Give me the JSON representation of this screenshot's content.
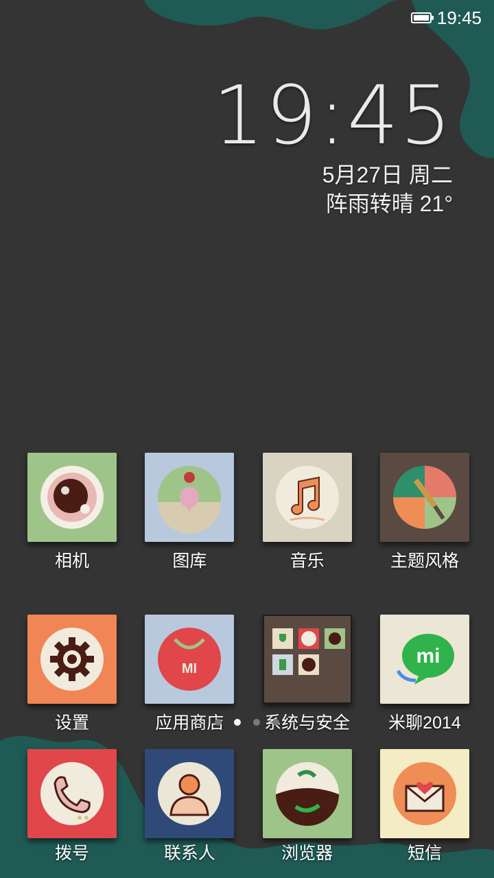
{
  "status_bar": {
    "time": "19:45",
    "battery_icon": "battery-full-icon"
  },
  "clock_widget": {
    "time": "19:45",
    "date": "5月27日 周二",
    "weather": "阵雨转晴  21°"
  },
  "home_grid": {
    "row1": [
      {
        "label": "相机",
        "icon": "camera-icon"
      },
      {
        "label": "图库",
        "icon": "gallery-icon"
      },
      {
        "label": "音乐",
        "icon": "music-icon"
      },
      {
        "label": "主题风格",
        "icon": "theme-icon"
      }
    ],
    "row2": [
      {
        "label": "设置",
        "icon": "settings-gear-icon"
      },
      {
        "label": "应用商店",
        "icon": "app-store-icon"
      },
      {
        "label": "系统与安全",
        "icon": "folder-icon"
      },
      {
        "label": "米聊2014",
        "icon": "miliao-icon"
      }
    ]
  },
  "page_indicator": {
    "count": 4,
    "active_index": 1
  },
  "dock": [
    {
      "label": "拨号",
      "icon": "phone-icon"
    },
    {
      "label": "联系人",
      "icon": "contacts-icon"
    },
    {
      "label": "浏览器",
      "icon": "browser-icon"
    },
    {
      "label": "短信",
      "icon": "message-icon"
    }
  ],
  "colors": {
    "wallpaper": "#343434",
    "teal_accent": "#1f5a55",
    "green_tile": "#9fc48a",
    "blue_tile": "#b8c9dd",
    "orange_tile": "#f08556",
    "brown_tile": "#5a4a42",
    "red_tile": "#e0464a"
  }
}
